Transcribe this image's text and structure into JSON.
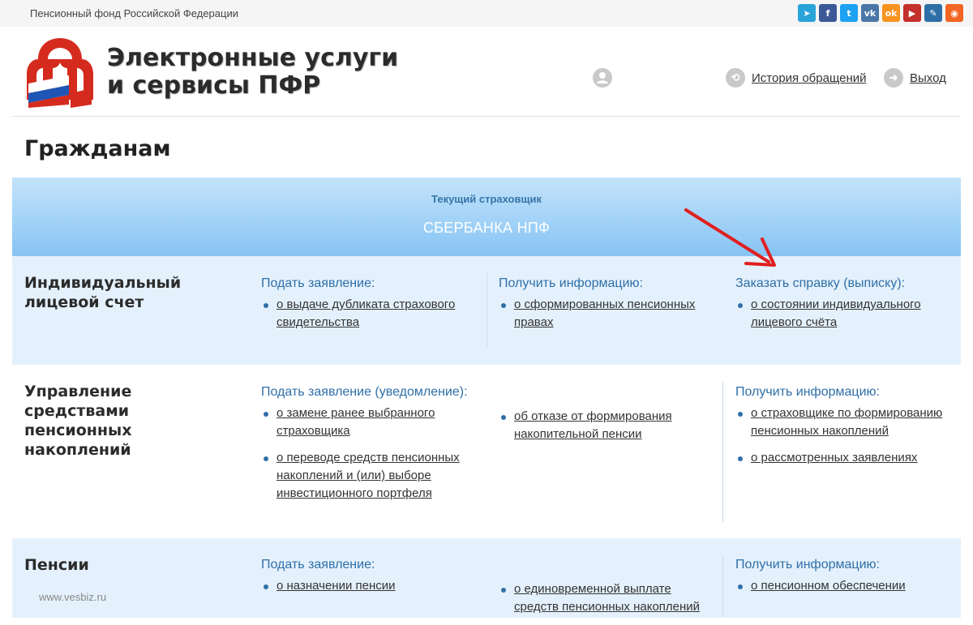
{
  "topbar": {
    "org_name": "Пенсионный фонд Российской Федерации",
    "social": [
      {
        "icon": "telegram-icon",
        "color": "#2aa3d9",
        "glyph": "➤"
      },
      {
        "icon": "facebook-icon",
        "color": "#3b5998",
        "glyph": "f"
      },
      {
        "icon": "twitter-icon",
        "color": "#1da1f2",
        "glyph": "t"
      },
      {
        "icon": "vk-icon",
        "color": "#4a76a8",
        "glyph": "vk"
      },
      {
        "icon": "odnoklassniki-icon",
        "color": "#f7931e",
        "glyph": "ok"
      },
      {
        "icon": "youtube-icon",
        "color": "#c4302b",
        "glyph": "▶"
      },
      {
        "icon": "livejournal-icon",
        "color": "#2f6fa8",
        "glyph": "✎"
      },
      {
        "icon": "rss-icon",
        "color": "#f26522",
        "glyph": "◉"
      }
    ]
  },
  "header": {
    "title_line1": "Электронные услуги",
    "title_line2": "и сервисы ПФР",
    "history_label": "История обращений",
    "logout_label": "Выход"
  },
  "page_title": "Гражданам",
  "insurer": {
    "label": "Текущий страховщик",
    "value": "СБЕРБАНКА НПФ"
  },
  "sections": [
    {
      "title": "Индивидуальный лицевой счет",
      "columns": [
        {
          "heading": "Подать заявление:",
          "items": [
            "о выдаче дубликата страхового свидетельства"
          ]
        },
        {
          "heading": "Получить информацию:",
          "items": [
            "о сформированных пенсионных правах"
          ]
        },
        {
          "heading": "Заказать справку (выписку):",
          "items": [
            "о состоянии индивидуального лицевого счёта"
          ]
        }
      ]
    },
    {
      "title": "Управление средствами пенсионных накоплений",
      "columns": [
        {
          "heading": "Подать заявление (уведомление):",
          "items": [
            "о замене ранее выбранного страховщика",
            "о переводе средств пенсионных накоплений и (или) выборе инвестиционного портфеля"
          ]
        },
        {
          "heading": "",
          "items": [
            "об отказе от формирования накопительной пенсии"
          ]
        },
        {
          "heading": "Получить информацию:",
          "items": [
            "о страховщике по формированию пенсионных накоплений",
            "о рассмотренных заявлениях"
          ]
        }
      ]
    },
    {
      "title": "Пенсии",
      "columns": [
        {
          "heading": "Подать заявление:",
          "items": [
            "о назначении пенсии"
          ]
        },
        {
          "heading": "",
          "items": [
            "о единовременной выплате средств пенсионных накоплений"
          ]
        },
        {
          "heading": "Получить информацию:",
          "items": [
            "о пенсионном обеспечении"
          ]
        }
      ]
    }
  ],
  "watermark": "www.vesbiz.ru",
  "colors": {
    "accent": "#2f6fa8",
    "annotation_arrow": "#e02020",
    "logo_red": "#d52b1e"
  }
}
